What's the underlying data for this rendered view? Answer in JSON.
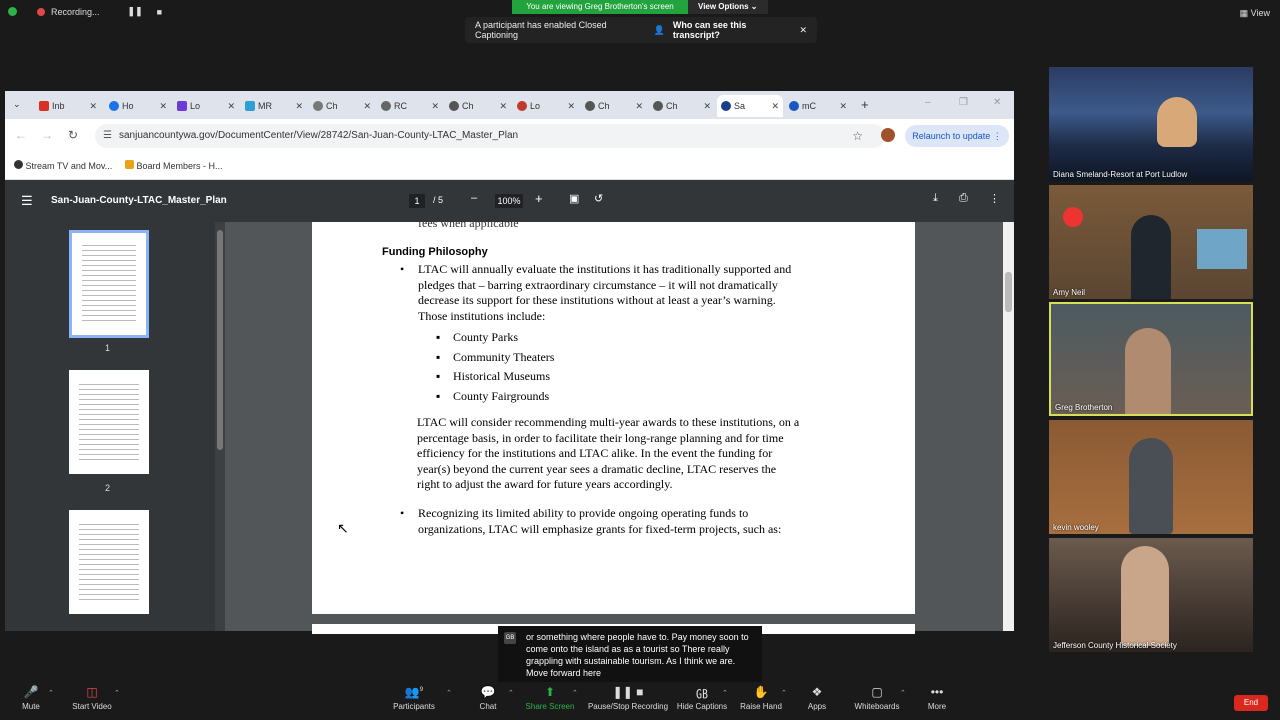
{
  "zoom_top": {
    "recording_label": "Recording...",
    "viewing_banner": "You are viewing Greg Brotherton's screen",
    "view_options_label": "View Options",
    "cc_notice": "A participant has enabled Closed Captioning",
    "cc_link": "Who can see this transcript?",
    "view_label": "View"
  },
  "browser": {
    "tabs": [
      {
        "label": "Inb"
      },
      {
        "label": "Ho"
      },
      {
        "label": "Lo"
      },
      {
        "label": "MR"
      },
      {
        "label": "Ch"
      },
      {
        "label": "RC"
      },
      {
        "label": "Ch"
      },
      {
        "label": "Lo"
      },
      {
        "label": "Ch"
      },
      {
        "label": "Ch"
      },
      {
        "label": "Sa"
      },
      {
        "label": "mC"
      }
    ],
    "url": "sanjuancountywa.gov/DocumentCenter/View/28742/San-Juan-County-LTAC_Master_Plan",
    "relaunch_label": "Relaunch to update",
    "bookmarks": [
      "Stream TV and Mov...",
      "Board Members - H..."
    ]
  },
  "pdf": {
    "title": "San-Juan-County-LTAC_Master_Plan",
    "page_current": "1",
    "page_total": "/ 5",
    "zoom": "100%",
    "thumb_labels": [
      "1",
      "2"
    ],
    "top_fragment": "fees when applicable",
    "heading": "Funding Philosophy",
    "bullet1_lines": [
      "LTAC will annually evaluate the institutions it has traditionally supported and",
      "pledges that – barring extraordinary circumstance – it will not dramatically",
      "decrease its support for these institutions without at least a year’s warning.",
      "Those institutions include:"
    ],
    "sub_bullets": [
      "County Parks",
      "Community Theaters",
      "Historical Museums",
      "County Fairgrounds"
    ],
    "para_lines": [
      "LTAC will consider recommending multi-year awards to these institutions, on a",
      "percentage basis, in order to facilitate their long-range planning and for time",
      "efficiency for the institutions and LTAC alike.  In the event the funding for",
      "year(s) beyond the current year sees a dramatic decline, LTAC reserves the",
      "right to adjust the award for future years accordingly."
    ],
    "bullet2_lines": [
      "Recognizing its limited ability to provide ongoing operating funds to",
      "organizations, LTAC will emphasize grants for fixed-term projects, such as:"
    ]
  },
  "participants": [
    {
      "name": "Diana Smeland-Resort at Port Ludlow"
    },
    {
      "name": "Amy Neil"
    },
    {
      "name": "Greg Brotherton"
    },
    {
      "name": "kevin wooley"
    },
    {
      "name": "Jefferson County Historical Society"
    }
  ],
  "caption": {
    "badge": "GB",
    "text": "or something where people have to. Pay money soon to come onto the island as as a tourist so There really grappling with sustainable tourism. As I think we are. Move forward here"
  },
  "toolbar": {
    "mute": "Mute",
    "start_video": "Start Video",
    "participants": "Participants",
    "participants_count": "9",
    "chat": "Chat",
    "share_screen": "Share Screen",
    "pause_recording": "Pause/Stop Recording",
    "hide_captions": "Hide Captions",
    "raise_hand": "Raise Hand",
    "apps": "Apps",
    "whiteboards": "Whiteboards",
    "more": "More",
    "end": "End"
  }
}
